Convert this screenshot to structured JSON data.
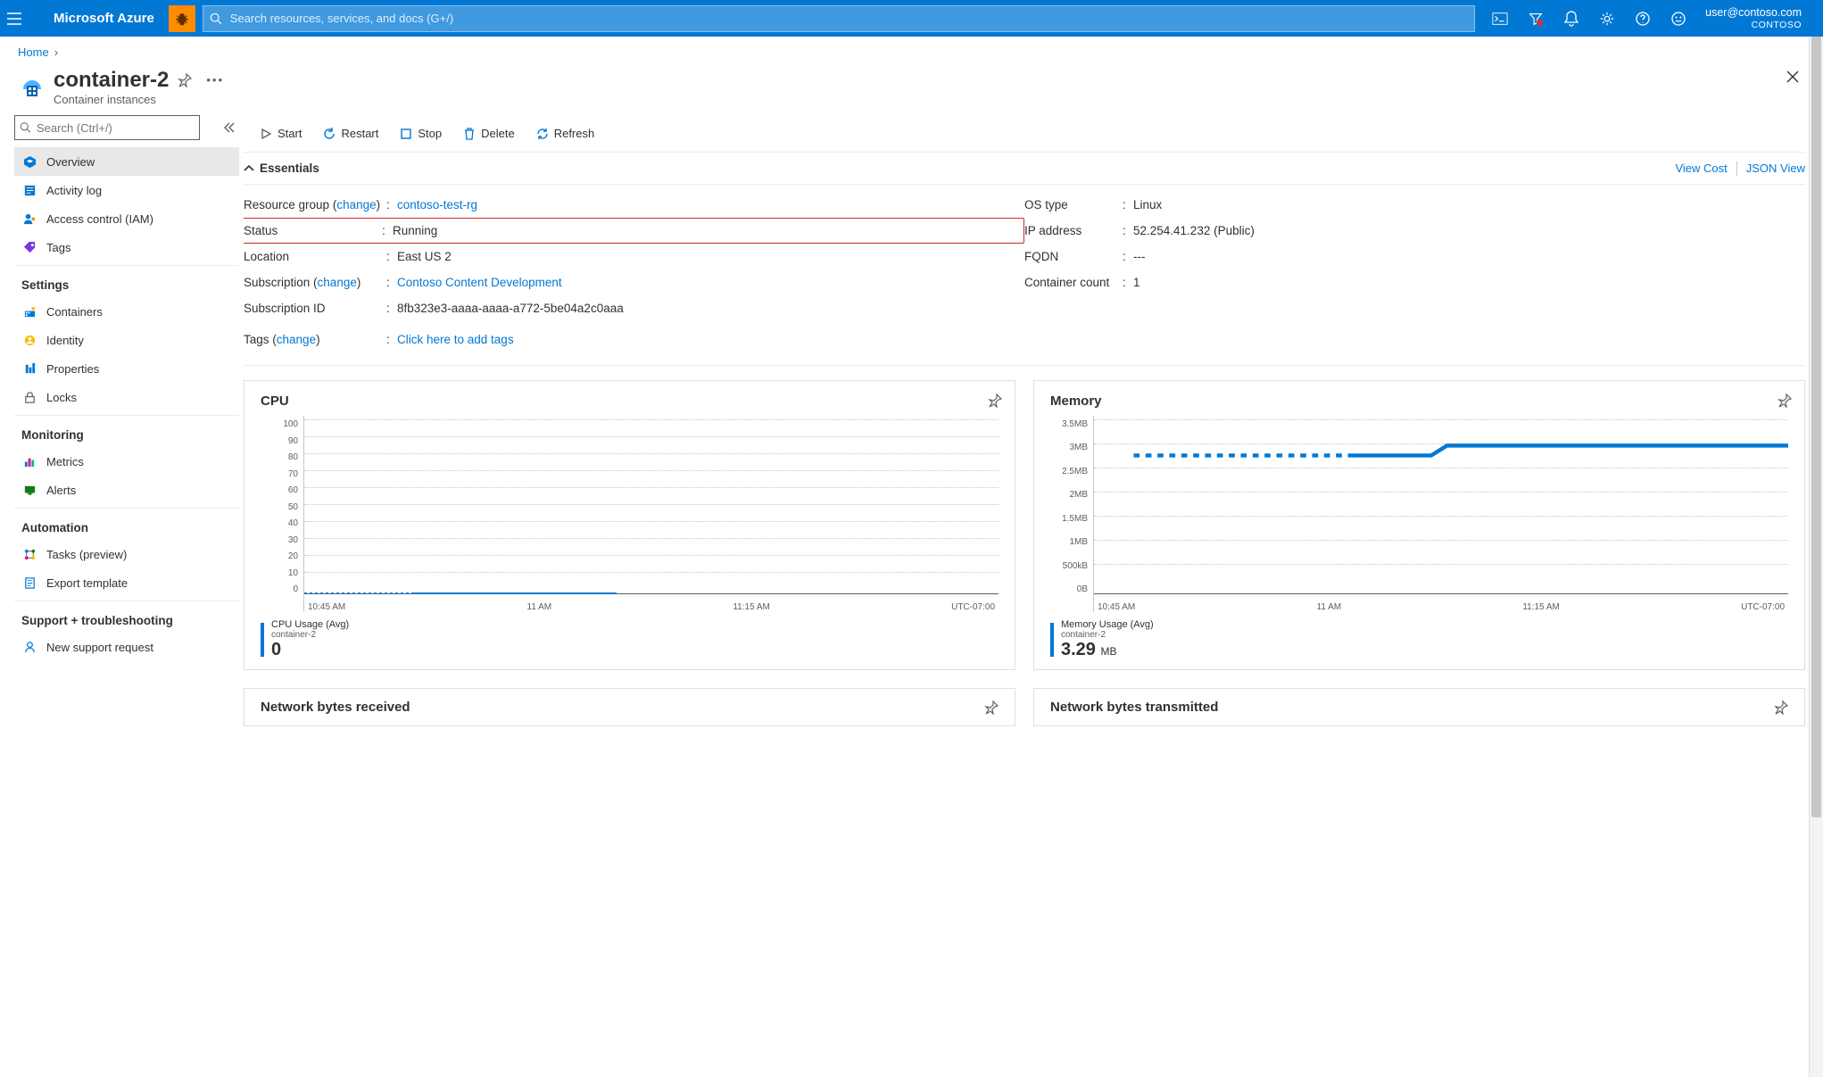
{
  "topbar": {
    "brand": "Microsoft Azure",
    "search_placeholder": "Search resources, services, and docs (G+/)",
    "account_email": "user@contoso.com",
    "account_tenant": "CONTOSO"
  },
  "breadcrumb": {
    "home": "Home"
  },
  "resource": {
    "title": "container-2",
    "subtitle": "Container instances"
  },
  "sidebar": {
    "search_placeholder": "Search (Ctrl+/)",
    "items_top": [
      {
        "label": "Overview",
        "icon": "overview",
        "selected": true
      },
      {
        "label": "Activity log",
        "icon": "activity"
      },
      {
        "label": "Access control (IAM)",
        "icon": "iam"
      },
      {
        "label": "Tags",
        "icon": "tags"
      }
    ],
    "heading_settings": "Settings",
    "items_settings": [
      {
        "label": "Containers",
        "icon": "containers"
      },
      {
        "label": "Identity",
        "icon": "identity"
      },
      {
        "label": "Properties",
        "icon": "properties"
      },
      {
        "label": "Locks",
        "icon": "locks"
      }
    ],
    "heading_monitoring": "Monitoring",
    "items_monitoring": [
      {
        "label": "Metrics",
        "icon": "metrics"
      },
      {
        "label": "Alerts",
        "icon": "alerts"
      }
    ],
    "heading_automation": "Automation",
    "items_automation": [
      {
        "label": "Tasks (preview)",
        "icon": "tasks"
      },
      {
        "label": "Export template",
        "icon": "export"
      }
    ],
    "heading_support": "Support + troubleshooting",
    "items_support": [
      {
        "label": "New support request",
        "icon": "support"
      }
    ]
  },
  "toolbar": {
    "start": "Start",
    "restart": "Restart",
    "stop": "Stop",
    "delete": "Delete",
    "refresh": "Refresh"
  },
  "essentials": {
    "toggle_label": "Essentials",
    "view_cost": "View Cost",
    "json_view": "JSON View",
    "left": {
      "resource_group_label": "Resource group",
      "change_link": "change",
      "resource_group_value": "contoso-test-rg",
      "status_label": "Status",
      "status_value": "Running",
      "location_label": "Location",
      "location_value": "East US 2",
      "subscription_label": "Subscription",
      "subscription_value": "Contoso Content Development",
      "subscription_id_label": "Subscription ID",
      "subscription_id_value": "8fb323e3-aaaa-aaaa-a772-5be04a2c0aaa",
      "tags_label": "Tags",
      "tags_value": "Click here to add tags"
    },
    "right": {
      "os_type_label": "OS type",
      "os_type_value": "Linux",
      "ip_label": "IP address",
      "ip_value": "52.254.41.232 (Public)",
      "fqdn_label": "FQDN",
      "fqdn_value": "---",
      "container_count_label": "Container count",
      "container_count_value": "1"
    }
  },
  "charts": {
    "cpu": {
      "title": "CPU",
      "legend_name": "CPU Usage (Avg)",
      "legend_resource": "container-2",
      "value": "0"
    },
    "memory": {
      "title": "Memory",
      "legend_name": "Memory Usage (Avg)",
      "legend_resource": "container-2",
      "value": "3.29",
      "unit": "MB"
    },
    "net_rx": "Network bytes received",
    "net_tx": "Network bytes transmitted",
    "timezone": "UTC-07:00",
    "x_ticks": [
      "10:45 AM",
      "11 AM",
      "11:15 AM"
    ]
  },
  "chart_data": [
    {
      "type": "line",
      "title": "CPU",
      "ylabel": "",
      "ylim": [
        0,
        100
      ],
      "y_ticks": [
        0,
        10,
        20,
        30,
        40,
        50,
        60,
        70,
        80,
        90,
        100
      ],
      "x_ticks": [
        "10:45 AM",
        "11 AM",
        "11:15 AM"
      ],
      "series": [
        {
          "name": "CPU Usage (Avg)",
          "resource": "container-2",
          "values_estimate": "flat at 0 across range",
          "current": 0
        }
      ],
      "timezone": "UTC-07:00"
    },
    {
      "type": "line",
      "title": "Memory",
      "ylabel": "",
      "ylim": [
        "0B",
        "3.5MB"
      ],
      "y_ticks": [
        "0B",
        "500kB",
        "1MB",
        "1.5MB",
        "2MB",
        "2.5MB",
        "3MB",
        "3.5MB"
      ],
      "x_ticks": [
        "10:45 AM",
        "11 AM",
        "11:15 AM"
      ],
      "series": [
        {
          "name": "Memory Usage (Avg)",
          "resource": "container-2",
          "values_estimate": "dotted ~3.2MB until ~11AM then solid ~3.29MB",
          "current": 3.29,
          "unit": "MB"
        }
      ],
      "timezone": "UTC-07:00"
    }
  ]
}
